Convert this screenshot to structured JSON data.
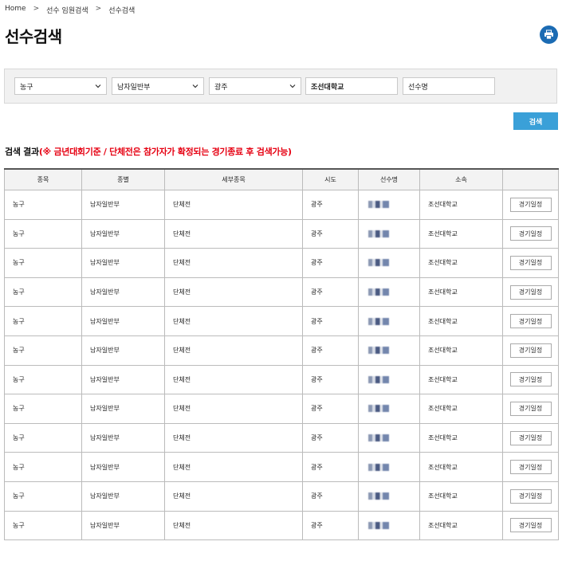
{
  "breadcrumb": {
    "home": "Home",
    "sep": ">",
    "level1": "선수 임원검색",
    "level2": "선수검색"
  },
  "page": {
    "title": "선수검색",
    "print_icon": "print-icon"
  },
  "search": {
    "sport": "농구",
    "division": "남자일반부",
    "region": "광주",
    "affiliation": "조선대학교",
    "name_placeholder": "선수명",
    "button": "검색"
  },
  "result": {
    "title_prefix": "검색 결과",
    "note": "(※ 금년대회기준 / 단체전은 참가자가 확정되는 경기종료 후 검색가능)"
  },
  "table": {
    "headers": [
      "종목",
      "종별",
      "세부종목",
      "시도",
      "선수명",
      "소속",
      ""
    ],
    "rows": [
      {
        "sport": "농구",
        "division": "남자일반부",
        "event": "단체전",
        "region": "광주",
        "affiliation": "조선대학교",
        "action": "경기일정"
      },
      {
        "sport": "농구",
        "division": "남자일반부",
        "event": "단체전",
        "region": "광주",
        "affiliation": "조선대학교",
        "action": "경기일정"
      },
      {
        "sport": "농구",
        "division": "남자일반부",
        "event": "단체전",
        "region": "광주",
        "affiliation": "조선대학교",
        "action": "경기일정"
      },
      {
        "sport": "농구",
        "division": "남자일반부",
        "event": "단체전",
        "region": "광주",
        "affiliation": "조선대학교",
        "action": "경기일정"
      },
      {
        "sport": "농구",
        "division": "남자일반부",
        "event": "단체전",
        "region": "광주",
        "affiliation": "조선대학교",
        "action": "경기일정"
      },
      {
        "sport": "농구",
        "division": "남자일반부",
        "event": "단체전",
        "region": "광주",
        "affiliation": "조선대학교",
        "action": "경기일정"
      },
      {
        "sport": "농구",
        "division": "남자일반부",
        "event": "단체전",
        "region": "광주",
        "affiliation": "조선대학교",
        "action": "경기일정"
      },
      {
        "sport": "농구",
        "division": "남자일반부",
        "event": "단체전",
        "region": "광주",
        "affiliation": "조선대학교",
        "action": "경기일정"
      },
      {
        "sport": "농구",
        "division": "남자일반부",
        "event": "단체전",
        "region": "광주",
        "affiliation": "조선대학교",
        "action": "경기일정"
      },
      {
        "sport": "농구",
        "division": "남자일반부",
        "event": "단체전",
        "region": "광주",
        "affiliation": "조선대학교",
        "action": "경기일정"
      },
      {
        "sport": "농구",
        "division": "남자일반부",
        "event": "단체전",
        "region": "광주",
        "affiliation": "조선대학교",
        "action": "경기일정"
      },
      {
        "sport": "농구",
        "division": "남자일반부",
        "event": "단체전",
        "region": "광주",
        "affiliation": "조선대학교",
        "action": "경기일정"
      }
    ]
  },
  "colors": {
    "print_button": "#1b6bb3",
    "search_button": "#3aa0d8",
    "note": "#e60012"
  }
}
